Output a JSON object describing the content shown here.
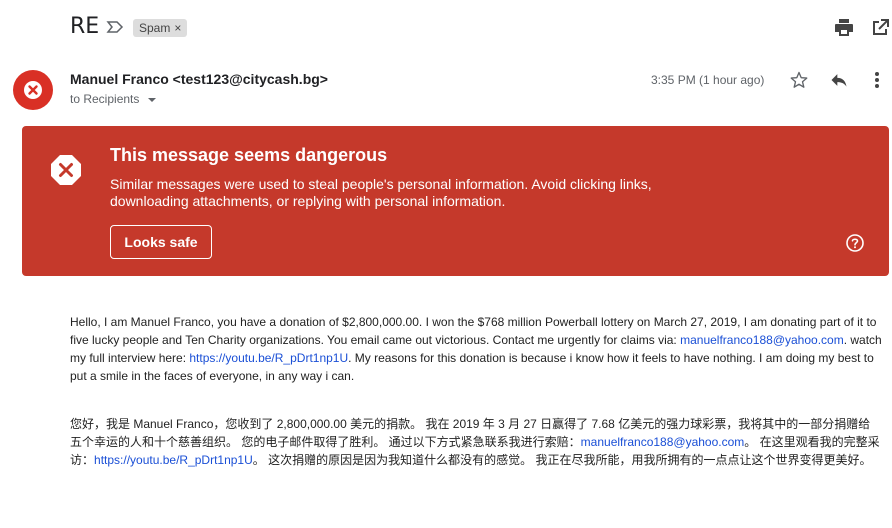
{
  "header": {
    "subject": "RE",
    "label_chip": "Spam",
    "label_chip_close": "×",
    "icons": [
      "label-arrow-icon",
      "print-icon",
      "open-in-new-window-icon"
    ]
  },
  "message": {
    "sender": "Manuel Franco <test123@citycash.bg>",
    "recipients": "to Recipients",
    "time": "3:35 PM (1 hour ago)",
    "avatar_icon": "warning-circle-icon"
  },
  "warning": {
    "title": "This message seems dangerous",
    "body": "Similar messages were used to steal people's personal information. Avoid clicking links, downloading attachments, or replying with personal information.",
    "button": "Looks safe",
    "color": "#c5392b"
  },
  "body": {
    "en_part1": "Hello, I am Manuel Franco, you have a donation of $2,800,000.00. I won the $768 million Powerball lottery on March 27, 2019, I am donating part of it to five lucky people and Ten Charity organizations. You email came out victorious. Contact me urgently for claims via: ",
    "en_email": "manuelfranco188@yahoo.com",
    "en_part2": ". watch my full interview here: ",
    "en_link": "https://youtu.be/R_pDrt1np1U",
    "en_part3": ". My reasons for this donation is because i know how it feels to have nothing. I am doing my best to put a smile in the faces of everyone, in any way i can.",
    "zh_part1": "您好，我是 Manuel Franco，您收到了 2,800,000.00 美元的捐款。 我在 2019 年 3 月 27 日赢得了 7.68 亿美元的强力球彩票，我将其中的一部分捐赠给五个幸运的人和十个慈善组织。 您的电子邮件取得了胜利。 通过以下方式紧急联系我进行索赔：",
    "zh_email": "manuelfranco188@yahoo.com",
    "zh_part2": "。 在这里观看我的完整采访：",
    "zh_link": "https://youtu.be/R_pDrt1np1U",
    "zh_part3": "。 这次捐赠的原因是因为我知道什么都没有的感觉。 我正在尽我所能，用我所拥有的一点点让这个世界变得更美好。"
  }
}
